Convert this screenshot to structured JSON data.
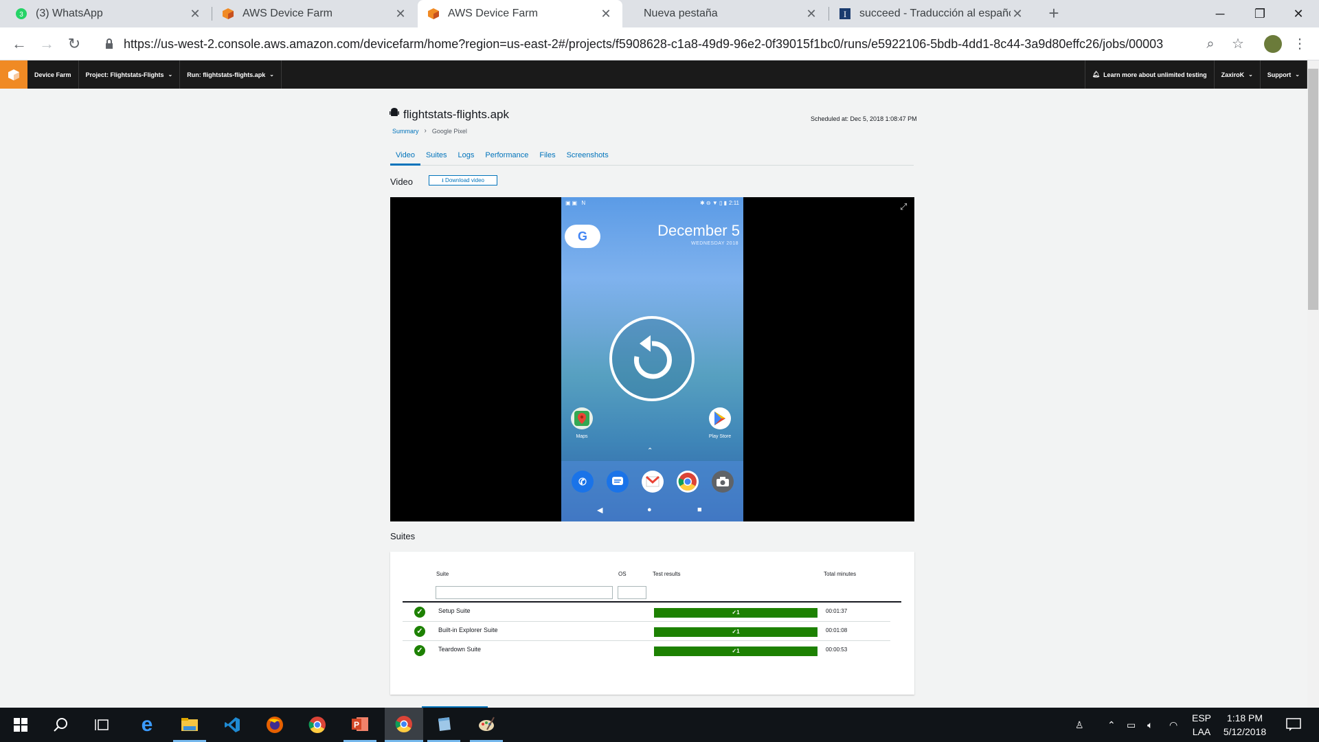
{
  "browser": {
    "tabs": [
      {
        "title": "(3) WhatsApp",
        "icon": "whatsapp-icon"
      },
      {
        "title": "AWS Device Farm",
        "icon": "aws-cube-icon"
      },
      {
        "title": "AWS Device Farm",
        "icon": "aws-cube-icon"
      },
      {
        "title": "Nueva pestaña",
        "icon": ""
      },
      {
        "title": "succeed - Traducción al español",
        "icon": "dictionary-icon"
      }
    ],
    "active_tab_index": 2,
    "url": "https://us-west-2.console.aws.amazon.com/devicefarm/home?region=us-east-2#/projects/f5908628-c1a8-49d9-96e2-0f39015f1bc0/runs/e5922106-5bdb-4dd1-8c44-3a9d80effc26/jobs/00003",
    "whatsapp_badge": "3"
  },
  "awsnav": {
    "service": "Device Farm",
    "project": "Project: Flightstats-Flights",
    "run": "Run: flightstats-flights.apk",
    "learn_more": "Learn more about unlimited testing",
    "user": "ZaxiroK",
    "support": "Support"
  },
  "page": {
    "title": "flightstats-flights.apk",
    "breadcrumb": {
      "summary": "Summary",
      "device": "Google Pixel"
    },
    "scheduled": "Scheduled at: Dec 5, 2018 1:08:47 PM",
    "tabs": [
      "Video",
      "Suites",
      "Logs",
      "Performance",
      "Files",
      "Screenshots"
    ],
    "selected_tab": "Video",
    "video_label": "Video",
    "download_label": "Download video",
    "suites_label": "Suites"
  },
  "phone": {
    "time": "2:11",
    "date": "December 5",
    "weekday": "WEDNESDAY 2018",
    "google_letter": "G",
    "apps": [
      {
        "label": "Maps",
        "icon": "maps-icon"
      },
      {
        "label": "Play Store",
        "icon": "play-store-icon"
      }
    ],
    "dock_icons": [
      "phone-icon",
      "messages-icon",
      "gmail-icon",
      "chrome-icon",
      "camera-icon"
    ]
  },
  "suites_table": {
    "columns": [
      "Suite",
      "OS",
      "Test results",
      "Total minutes"
    ],
    "rows": [
      {
        "name": "Setup Suite",
        "result": "1",
        "minutes": "00:01:37"
      },
      {
        "name": "Built-in Explorer Suite",
        "result": "1",
        "minutes": "00:01:08"
      },
      {
        "name": "Teardown Suite",
        "result": "1",
        "minutes": "00:00:53"
      }
    ],
    "passed_color": "#1d8102"
  },
  "taskbar": {
    "language": "ESP",
    "layout": "LAA",
    "time": "1:18 PM",
    "date": "5/12/2018",
    "apps": [
      "start-icon",
      "search-icon",
      "task-view-icon",
      "edge-icon",
      "file-explorer-icon",
      "vscode-icon",
      "firefox-icon",
      "chrome-icon",
      "powerpoint-icon",
      "chrome-canary-icon",
      "notepad-icon",
      "paint-icon"
    ]
  }
}
